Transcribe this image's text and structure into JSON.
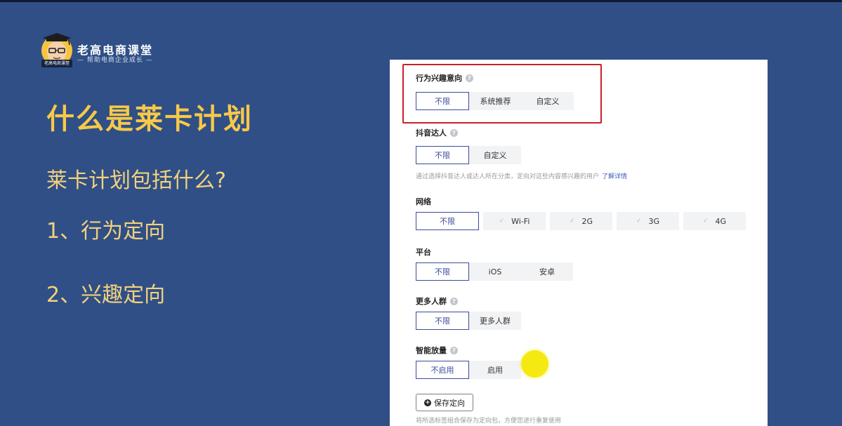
{
  "brand": {
    "name": "老高电商课堂",
    "slogan": "— 帮助电商企业成长 —",
    "badge": "老高电商课堂",
    "mascot_icon": "cartoon-teacher-avatar"
  },
  "slide": {
    "title": "什么是莱卡计划",
    "subtitle": "莱卡计划包括什么?",
    "items": [
      "1、行为定向",
      "2、兴趣定向"
    ]
  },
  "panel": {
    "sections": [
      {
        "label": "行为兴趣意向",
        "help": "?",
        "options": [
          "不限",
          "系统推荐",
          "自定义"
        ],
        "selected": "不限"
      },
      {
        "label": "抖音达人",
        "help": "?",
        "options": [
          "不限",
          "自定义"
        ],
        "selected": "不限",
        "hint": "通过选择抖音达人或达人所在分类，定向对这些内容感兴趣的用户",
        "hint_link": "了解详情"
      },
      {
        "label": "网络",
        "options": [
          "不限",
          "Wi-Fi",
          "2G",
          "3G",
          "4G"
        ],
        "selected": "不限"
      },
      {
        "label": "平台",
        "options": [
          "不限",
          "iOS",
          "安卓"
        ],
        "selected": "不限"
      },
      {
        "label": "更多人群",
        "help": "?",
        "options": [
          "不限",
          "更多人群"
        ],
        "selected": "不限"
      },
      {
        "label": "智能放量",
        "help": "?",
        "options": [
          "不启用",
          "启用"
        ],
        "selected": "不启用"
      }
    ],
    "save_button": "保存定向",
    "save_hint": "将所选标签组合保存为定向包，方便您进行重复使用"
  },
  "colors": {
    "background": "#2f4f86",
    "title_yellow": "#f7c948",
    "text_yellow": "#f3d17d",
    "selected_border": "#3c4b9c",
    "highlight_red": "#c8202e",
    "cursor_yellow": "#f4ea12"
  }
}
